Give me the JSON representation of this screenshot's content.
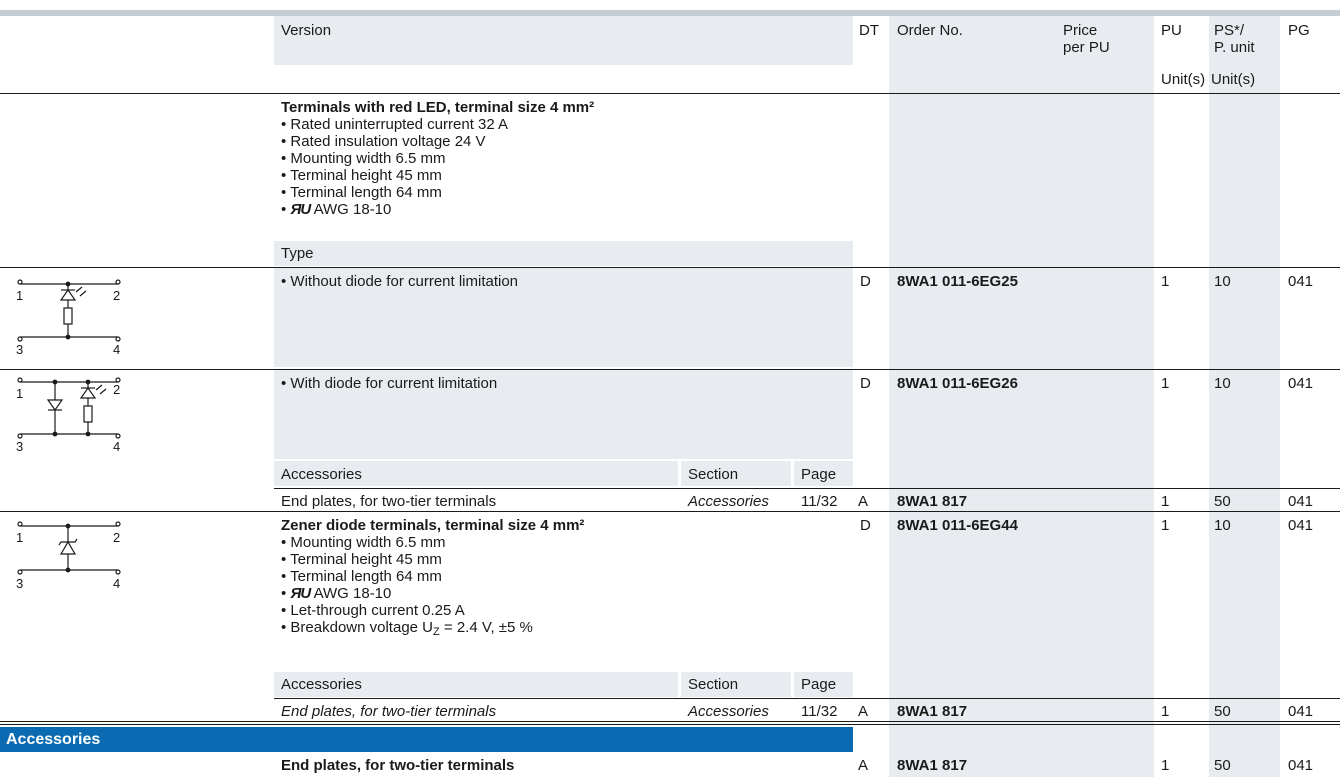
{
  "header": {
    "version": "Version",
    "dt": "DT",
    "order_no": "Order No.",
    "price_line1": "Price",
    "price_line2": "per PU",
    "pu": "PU",
    "ps_line1": "PS*/",
    "ps_line2": "P. unit",
    "pg": "PG",
    "unit_pu": "Unit(s)",
    "unit_ps": "Unit(s)"
  },
  "led_section": {
    "title": "Terminals with red LED, terminal size 4 mm²",
    "bullets": [
      "• Rated uninterrupted current 32 A",
      "• Rated insulation voltage 24 V",
      "• Mounting width 6.5 mm",
      "• Terminal height 45 mm",
      "• Terminal length 64 mm"
    ],
    "ul_bullet_prefix": "•",
    "ul_logo": "ᴿᵁ",
    "ul_bullet_text": "AWG 18-10",
    "type_label": "Type",
    "rows": [
      {
        "version": "• Without diode for current limitation",
        "dt": "D",
        "order_no": "8WA1 011-6EG25",
        "pu": "1",
        "ps": "10",
        "pg": "041"
      },
      {
        "version": "• With diode for current limitation",
        "dt": "D",
        "order_no": "8WA1 011-6EG26",
        "pu": "1",
        "ps": "10",
        "pg": "041"
      }
    ],
    "accessories_header": {
      "label": "Accessories",
      "section": "Section",
      "page": "Page"
    },
    "accessory": {
      "version": "End plates, for two-tier terminals",
      "section": "Accessories",
      "page": "11/32",
      "dt": "A",
      "order_no": "8WA1 817",
      "pu": "1",
      "ps": "50",
      "pg": "041"
    }
  },
  "zener_section": {
    "title": "Zener diode terminals, terminal size 4 mm²",
    "dt": "D",
    "order_no": "8WA1 011-6EG44",
    "pu": "1",
    "ps": "10",
    "pg": "041",
    "bullets_before_ul": [
      "• Mounting width 6.5 mm",
      "• Terminal height 45 mm",
      "• Terminal length 64 mm"
    ],
    "ul_bullet_text": "AWG 18-10",
    "bullet_let_through": "• Let-through current 0.25 A",
    "breakdown_prefix": "• Breakdown voltage U",
    "breakdown_sub": "Z",
    "breakdown_suffix": " = 2.4 V, ±5 %",
    "accessories_header": {
      "label": "Accessories",
      "section": "Section",
      "page": "Page"
    },
    "accessory": {
      "version": "End plates, for two-tier terminals",
      "section": "Accessories",
      "page": "11/32",
      "dt": "A",
      "order_no": "8WA1 817",
      "pu": "1",
      "ps": "50",
      "pg": "041"
    }
  },
  "accessories_bar": {
    "label": "Accessories",
    "row": {
      "version": "End plates, for two-tier terminals",
      "dt": "A",
      "order_no": "8WA1 817",
      "pu": "1",
      "ps": "50",
      "pg": "041"
    }
  },
  "diagram_labels": {
    "n1": "1",
    "n2": "2",
    "n3": "3",
    "n4": "4"
  },
  "colors": {
    "accent_blue": "#0a6bb3",
    "panel_gray": "#e8ecf0",
    "top_bar": "#c5ccd3"
  }
}
